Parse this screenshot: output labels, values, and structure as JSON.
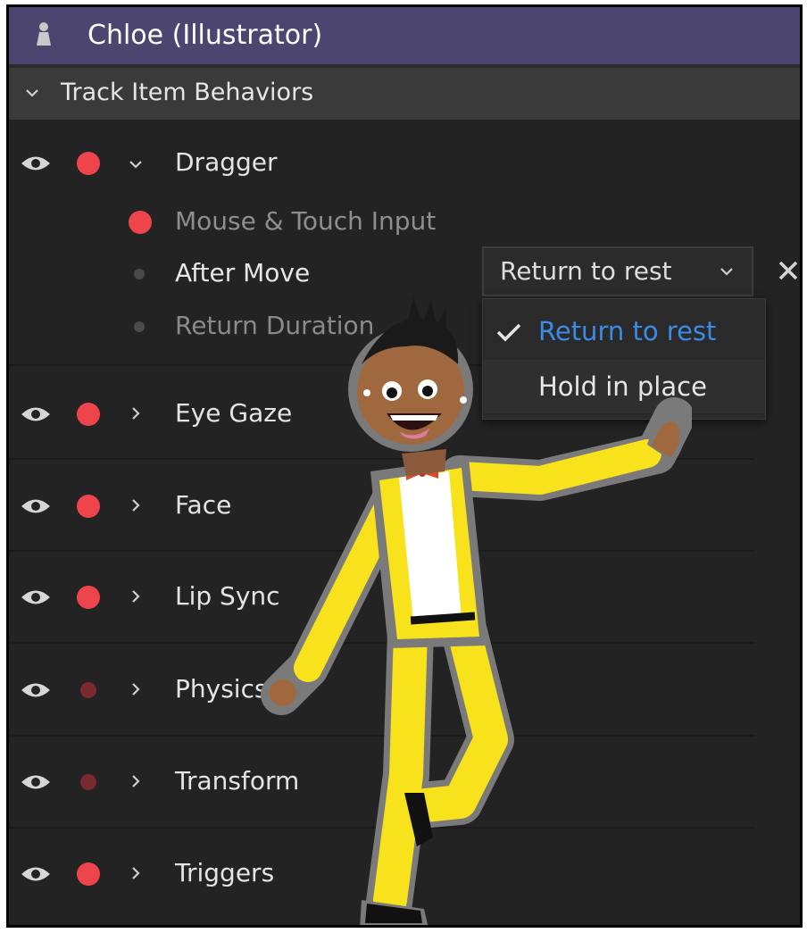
{
  "panel": {
    "title": "Chloe (Illustrator)",
    "section": "Track Item Behaviors"
  },
  "behaviors": [
    {
      "name": "Dragger",
      "expanded": true,
      "armed": true
    },
    {
      "name": "Eye Gaze",
      "expanded": false,
      "armed": true
    },
    {
      "name": "Face",
      "expanded": false,
      "armed": true
    },
    {
      "name": "Lip Sync",
      "expanded": false,
      "armed": true
    },
    {
      "name": "Physics",
      "expanded": false,
      "armed": false
    },
    {
      "name": "Transform",
      "expanded": false,
      "armed": false
    },
    {
      "name": "Triggers",
      "expanded": false,
      "armed": true
    }
  ],
  "dragger_params": {
    "mouse_touch": "Mouse & Touch Input",
    "after_move": "After Move",
    "return_duration": "Return Duration"
  },
  "after_move_dropdown": {
    "value": "Return to rest",
    "options": [
      "Return to rest",
      "Hold in place"
    ],
    "selected_index": 0
  },
  "colors": {
    "title_bar": "#4c4570",
    "armed_dot": "#f0444c",
    "disarmed_dot": "#7a2a2e",
    "selected_option": "#3b8be6",
    "suit": "#f7e21c"
  },
  "icons": [
    "person-icon",
    "eye-icon",
    "chevron-down-icon",
    "chevron-right-icon",
    "close-icon",
    "checkmark-icon"
  ]
}
